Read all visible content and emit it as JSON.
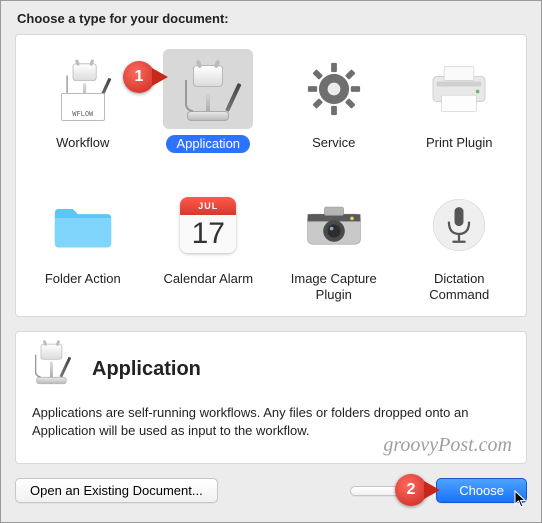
{
  "prompt": "Choose a type for your document:",
  "calendar": {
    "month": "JUL",
    "day": "17"
  },
  "workflow_tag": "WFLOW",
  "items": [
    {
      "label": "Workflow"
    },
    {
      "label": "Application",
      "selected": true
    },
    {
      "label": "Service"
    },
    {
      "label": "Print Plugin"
    },
    {
      "label": "Folder Action"
    },
    {
      "label": "Calendar Alarm"
    },
    {
      "label": "Image Capture Plugin"
    },
    {
      "label": "Dictation Command"
    }
  ],
  "description": {
    "title": "Application",
    "text": "Applications are self-running workflows. Any files or folders dropped onto an Application will be used as input to the workflow."
  },
  "buttons": {
    "open": "Open an Existing Document...",
    "choose": "Choose"
  },
  "callouts": {
    "one": "1",
    "two": "2"
  },
  "watermark": "groovyPost.com"
}
